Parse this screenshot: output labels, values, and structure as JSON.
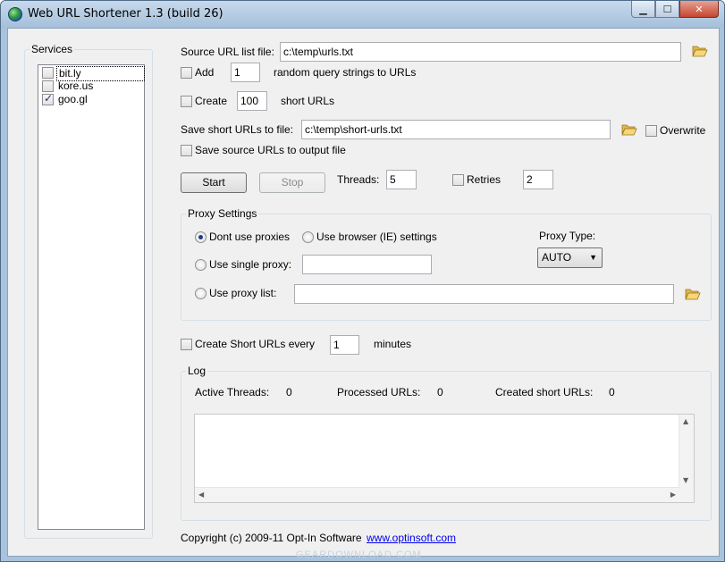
{
  "window": {
    "title": "Web URL Shortener 1.3 (build 26)",
    "minimize_glyph": "▁",
    "maximize_glyph": "☐",
    "close_glyph": "✕"
  },
  "services": {
    "label": "Services",
    "items": [
      {
        "label": "bit.ly",
        "checked": false
      },
      {
        "label": "kore.us",
        "checked": false
      },
      {
        "label": "goo.gl",
        "checked": true
      }
    ]
  },
  "source": {
    "label": "Source URL list file:",
    "value": "c:\\temp\\urls.txt"
  },
  "add": {
    "label": "Add",
    "value": "1",
    "suffix": "random query strings to URLs"
  },
  "create": {
    "label": "Create",
    "value": "100",
    "suffix": "short URLs"
  },
  "save": {
    "label": "Save short URLs to file:",
    "value": "c:\\temp\\short-urls.txt",
    "overwrite_label": "Overwrite"
  },
  "save_source": {
    "label": "Save source URLs to output file"
  },
  "controls": {
    "start_label": "Start",
    "stop_label": "Stop",
    "threads_label": "Threads:",
    "threads_value": "5",
    "retries_label": "Retries",
    "retries_value": "2"
  },
  "proxy": {
    "group_label": "Proxy Settings",
    "dont_use": "Dont use proxies",
    "use_browser": "Use browser (IE) settings",
    "use_single": "Use single proxy:",
    "use_list": "Use proxy list:",
    "type_label": "Proxy Type:",
    "type_value": "AUTO",
    "selected": "dont_use"
  },
  "schedule": {
    "label": "Create Short URLs every",
    "value": "1",
    "suffix": "minutes"
  },
  "log": {
    "group_label": "Log",
    "active_threads_label": "Active Threads:",
    "active_threads_value": "0",
    "processed_label": "Processed URLs:",
    "processed_value": "0",
    "created_label": "Created short URLs:",
    "created_value": "0"
  },
  "footer": {
    "copyright": "Copyright (c) 2009-11 Opt-In Software",
    "link": "www.optinsoft.com",
    "watermark": "GEARDOWNLOAD.COM"
  }
}
